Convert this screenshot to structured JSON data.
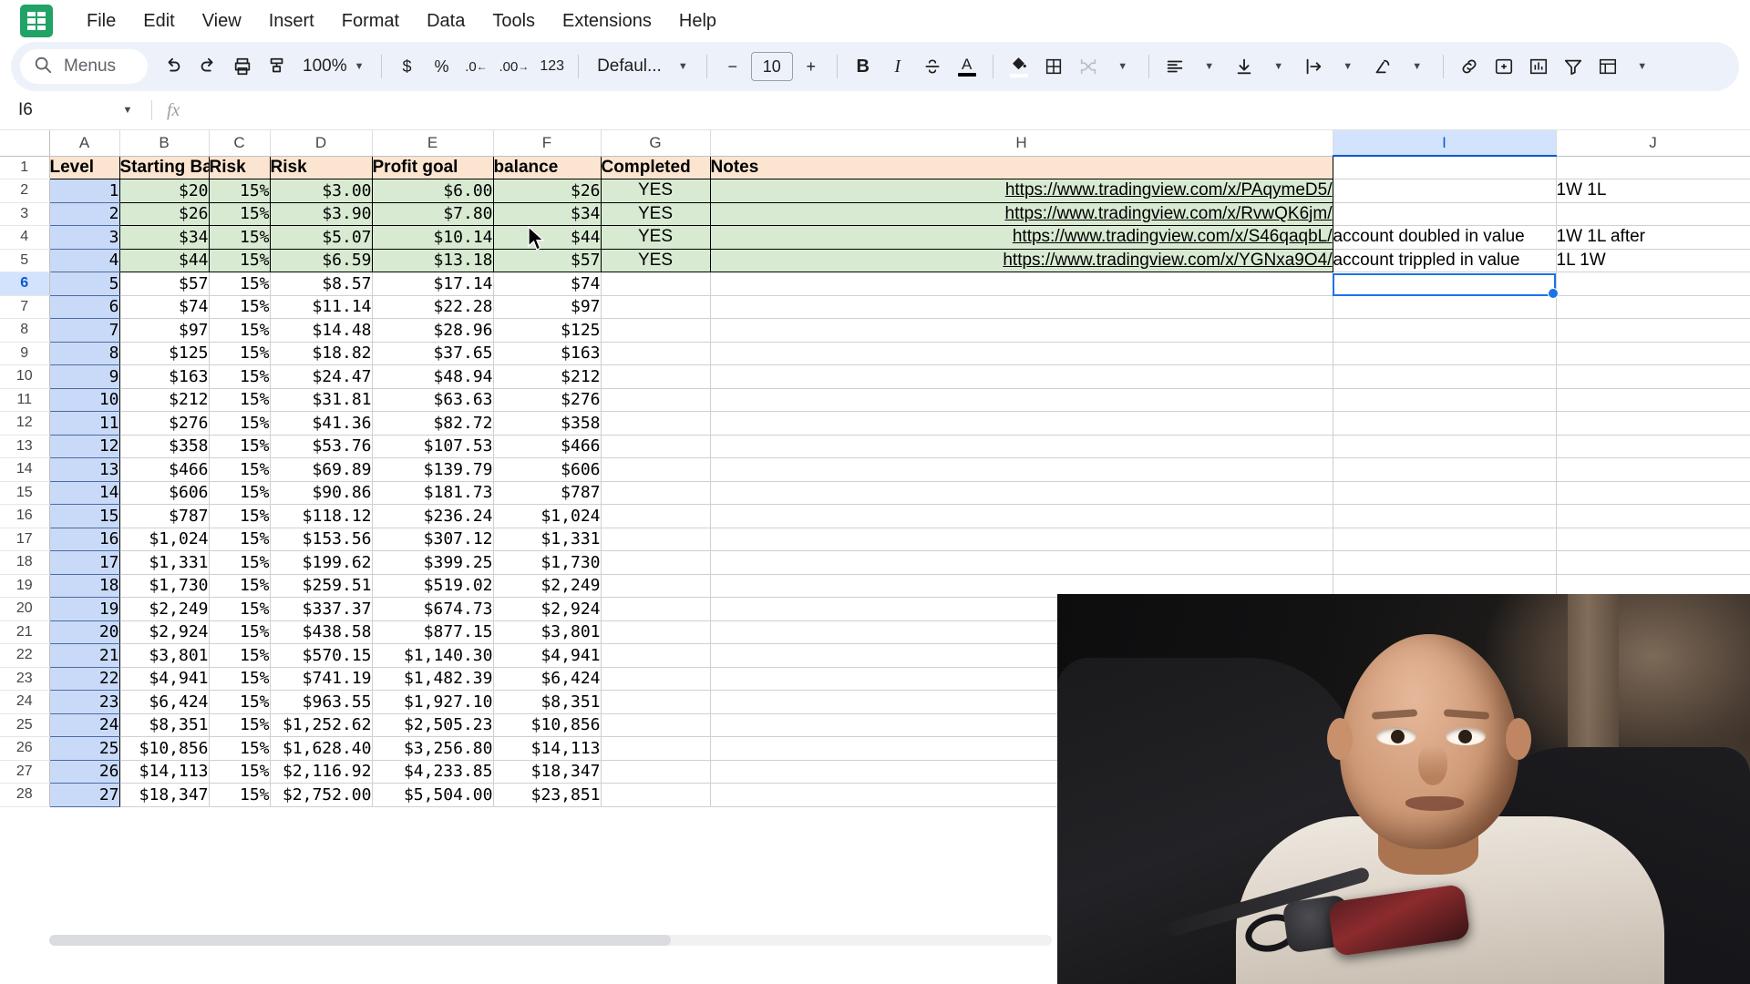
{
  "app": {
    "logo_icon": "sheets-logo-icon",
    "menus": [
      "File",
      "Edit",
      "View",
      "Insert",
      "Format",
      "Data",
      "Tools",
      "Extensions",
      "Help"
    ]
  },
  "toolbar": {
    "search_label": "Menus",
    "search_icon": "search-icon",
    "undo_icon": "undo-icon",
    "redo_icon": "redo-icon",
    "print_icon": "print-icon",
    "paint_format_icon": "paint-format-icon",
    "zoom_value": "100%",
    "currency_icon": "$",
    "percent_icon": "%",
    "decrease_decimal_icon": ".0",
    "increase_decimal_icon": ".00",
    "more_formats_icon": "123",
    "font_family": "Defaul...",
    "font_decrease_icon": "−",
    "font_size": "10",
    "font_increase_icon": "+",
    "bold_icon": "B",
    "italic_icon": "I",
    "strikethrough_icon": "S",
    "text_color_icon": "A",
    "fill_color_icon": "fill-color-icon",
    "borders_icon": "borders-icon",
    "merge_cells_icon": "merge-cells-icon",
    "halign_icon": "horizontal-align-icon",
    "valign_icon": "vertical-align-icon",
    "text_wrap_icon": "text-wrapping-icon",
    "text_rotation_icon": "text-rotation-icon",
    "insert_link_icon": "insert-link-icon",
    "insert_comment_icon": "insert-comment-icon",
    "insert_chart_icon": "insert-chart-icon",
    "filter_icon": "create-filter-icon",
    "functions_icon": "functions-icon",
    "more_icon": "more-options-icon"
  },
  "formula_bar": {
    "name_box": "I6",
    "fx_label": "fx",
    "formula_value": ""
  },
  "grid": {
    "selected_cell": "I6",
    "selected_column": "I",
    "selected_row": "6",
    "column_letters": [
      "A",
      "B",
      "C",
      "D",
      "E",
      "F",
      "G",
      "H",
      "I",
      "J"
    ],
    "row_numbers": [
      "1",
      "2",
      "3",
      "4",
      "5",
      "6",
      "7",
      "8",
      "9",
      "10",
      "11",
      "12",
      "13",
      "14",
      "15",
      "16",
      "17",
      "18",
      "19",
      "20",
      "21",
      "22",
      "23",
      "24",
      "25",
      "26",
      "27",
      "28"
    ],
    "headers": {
      "A": "Level",
      "B": "Starting Bal",
      "C": "Risk",
      "D": "Risk",
      "E": "Profit goal",
      "F": "balance",
      "G": "Completed",
      "H": "Notes",
      "I": "",
      "J": ""
    },
    "colors": {
      "header_fill": "#fce5d0",
      "completed_fill": "#d9ead3",
      "level_fill": "#c9daf8",
      "selection": "#1a73e8",
      "header_select": "#d3e3fd"
    },
    "rows": [
      {
        "row": "2",
        "level": "1",
        "starting": "$20",
        "risk_pct": "15%",
        "risk": "$3.00",
        "profit": "$6.00",
        "balance": "$26",
        "completed": "YES",
        "notes": "https://www.tradingview.com/x/PAqymeD5/",
        "i": "",
        "j": "1W 1L"
      },
      {
        "row": "3",
        "level": "2",
        "starting": "$26",
        "risk_pct": "15%",
        "risk": "$3.90",
        "profit": "$7.80",
        "balance": "$34",
        "completed": "YES",
        "notes": "https://www.tradingview.com/x/RvwQK6jm/",
        "i": "",
        "j": ""
      },
      {
        "row": "4",
        "level": "3",
        "starting": "$34",
        "risk_pct": "15%",
        "risk": "$5.07",
        "profit": "$10.14",
        "balance": "$44",
        "completed": "YES",
        "notes": "https://www.tradingview.com/x/S46qaqbL/",
        "i": "account doubled in value",
        "j": "1W 1L after"
      },
      {
        "row": "5",
        "level": "4",
        "starting": "$44",
        "risk_pct": "15%",
        "risk": "$6.59",
        "profit": "$13.18",
        "balance": "$57",
        "completed": "YES",
        "notes": "https://www.tradingview.com/x/YGNxa9O4/",
        "i": "account trippled in value",
        "j": "1L 1W"
      },
      {
        "row": "6",
        "level": "5",
        "starting": "$57",
        "risk_pct": "15%",
        "risk": "$8.57",
        "profit": "$17.14",
        "balance": "$74",
        "completed": "",
        "notes": "",
        "i": "",
        "j": ""
      },
      {
        "row": "7",
        "level": "6",
        "starting": "$74",
        "risk_pct": "15%",
        "risk": "$11.14",
        "profit": "$22.28",
        "balance": "$97",
        "completed": "",
        "notes": "",
        "i": "",
        "j": ""
      },
      {
        "row": "8",
        "level": "7",
        "starting": "$97",
        "risk_pct": "15%",
        "risk": "$14.48",
        "profit": "$28.96",
        "balance": "$125",
        "completed": "",
        "notes": "",
        "i": "",
        "j": ""
      },
      {
        "row": "9",
        "level": "8",
        "starting": "$125",
        "risk_pct": "15%",
        "risk": "$18.82",
        "profit": "$37.65",
        "balance": "$163",
        "completed": "",
        "notes": "",
        "i": "",
        "j": ""
      },
      {
        "row": "10",
        "level": "9",
        "starting": "$163",
        "risk_pct": "15%",
        "risk": "$24.47",
        "profit": "$48.94",
        "balance": "$212",
        "completed": "",
        "notes": "",
        "i": "",
        "j": ""
      },
      {
        "row": "11",
        "level": "10",
        "starting": "$212",
        "risk_pct": "15%",
        "risk": "$31.81",
        "profit": "$63.63",
        "balance": "$276",
        "completed": "",
        "notes": "",
        "i": "",
        "j": ""
      },
      {
        "row": "12",
        "level": "11",
        "starting": "$276",
        "risk_pct": "15%",
        "risk": "$41.36",
        "profit": "$82.72",
        "balance": "$358",
        "completed": "",
        "notes": "",
        "i": "",
        "j": ""
      },
      {
        "row": "13",
        "level": "12",
        "starting": "$358",
        "risk_pct": "15%",
        "risk": "$53.76",
        "profit": "$107.53",
        "balance": "$466",
        "completed": "",
        "notes": "",
        "i": "",
        "j": ""
      },
      {
        "row": "14",
        "level": "13",
        "starting": "$466",
        "risk_pct": "15%",
        "risk": "$69.89",
        "profit": "$139.79",
        "balance": "$606",
        "completed": "",
        "notes": "",
        "i": "",
        "j": ""
      },
      {
        "row": "15",
        "level": "14",
        "starting": "$606",
        "risk_pct": "15%",
        "risk": "$90.86",
        "profit": "$181.73",
        "balance": "$787",
        "completed": "",
        "notes": "",
        "i": "",
        "j": ""
      },
      {
        "row": "16",
        "level": "15",
        "starting": "$787",
        "risk_pct": "15%",
        "risk": "$118.12",
        "profit": "$236.24",
        "balance": "$1,024",
        "completed": "",
        "notes": "",
        "i": "",
        "j": ""
      },
      {
        "row": "17",
        "level": "16",
        "starting": "$1,024",
        "risk_pct": "15%",
        "risk": "$153.56",
        "profit": "$307.12",
        "balance": "$1,331",
        "completed": "",
        "notes": "",
        "i": "",
        "j": ""
      },
      {
        "row": "18",
        "level": "17",
        "starting": "$1,331",
        "risk_pct": "15%",
        "risk": "$199.62",
        "profit": "$399.25",
        "balance": "$1,730",
        "completed": "",
        "notes": "",
        "i": "",
        "j": ""
      },
      {
        "row": "19",
        "level": "18",
        "starting": "$1,730",
        "risk_pct": "15%",
        "risk": "$259.51",
        "profit": "$519.02",
        "balance": "$2,249",
        "completed": "",
        "notes": "",
        "i": "",
        "j": ""
      },
      {
        "row": "20",
        "level": "19",
        "starting": "$2,249",
        "risk_pct": "15%",
        "risk": "$337.37",
        "profit": "$674.73",
        "balance": "$2,924",
        "completed": "",
        "notes": "",
        "i": "",
        "j": ""
      },
      {
        "row": "21",
        "level": "20",
        "starting": "$2,924",
        "risk_pct": "15%",
        "risk": "$438.58",
        "profit": "$877.15",
        "balance": "$3,801",
        "completed": "",
        "notes": "",
        "i": "",
        "j": ""
      },
      {
        "row": "22",
        "level": "21",
        "starting": "$3,801",
        "risk_pct": "15%",
        "risk": "$570.15",
        "profit": "$1,140.30",
        "balance": "$4,941",
        "completed": "",
        "notes": "",
        "i": "",
        "j": ""
      },
      {
        "row": "23",
        "level": "22",
        "starting": "$4,941",
        "risk_pct": "15%",
        "risk": "$741.19",
        "profit": "$1,482.39",
        "balance": "$6,424",
        "completed": "",
        "notes": "",
        "i": "",
        "j": ""
      },
      {
        "row": "24",
        "level": "23",
        "starting": "$6,424",
        "risk_pct": "15%",
        "risk": "$963.55",
        "profit": "$1,927.10",
        "balance": "$8,351",
        "completed": "",
        "notes": "",
        "i": "",
        "j": ""
      },
      {
        "row": "25",
        "level": "24",
        "starting": "$8,351",
        "risk_pct": "15%",
        "risk": "$1,252.62",
        "profit": "$2,505.23",
        "balance": "$10,856",
        "completed": "",
        "notes": "",
        "i": "",
        "j": ""
      },
      {
        "row": "26",
        "level": "25",
        "starting": "$10,856",
        "risk_pct": "15%",
        "risk": "$1,628.40",
        "profit": "$3,256.80",
        "balance": "$14,113",
        "completed": "",
        "notes": "",
        "i": "",
        "j": ""
      },
      {
        "row": "27",
        "level": "26",
        "starting": "$14,113",
        "risk_pct": "15%",
        "risk": "$2,116.92",
        "profit": "$4,233.85",
        "balance": "$18,347",
        "completed": "",
        "notes": "",
        "i": "",
        "j": ""
      },
      {
        "row": "28",
        "level": "27",
        "starting": "$18,347",
        "risk_pct": "15%",
        "risk": "$2,752.00",
        "profit": "$5,504.00",
        "balance": "$23,851",
        "completed": "",
        "notes": "",
        "i": "",
        "j": ""
      }
    ]
  },
  "overlay": {
    "webcam_label": "webcam-video-overlay"
  }
}
